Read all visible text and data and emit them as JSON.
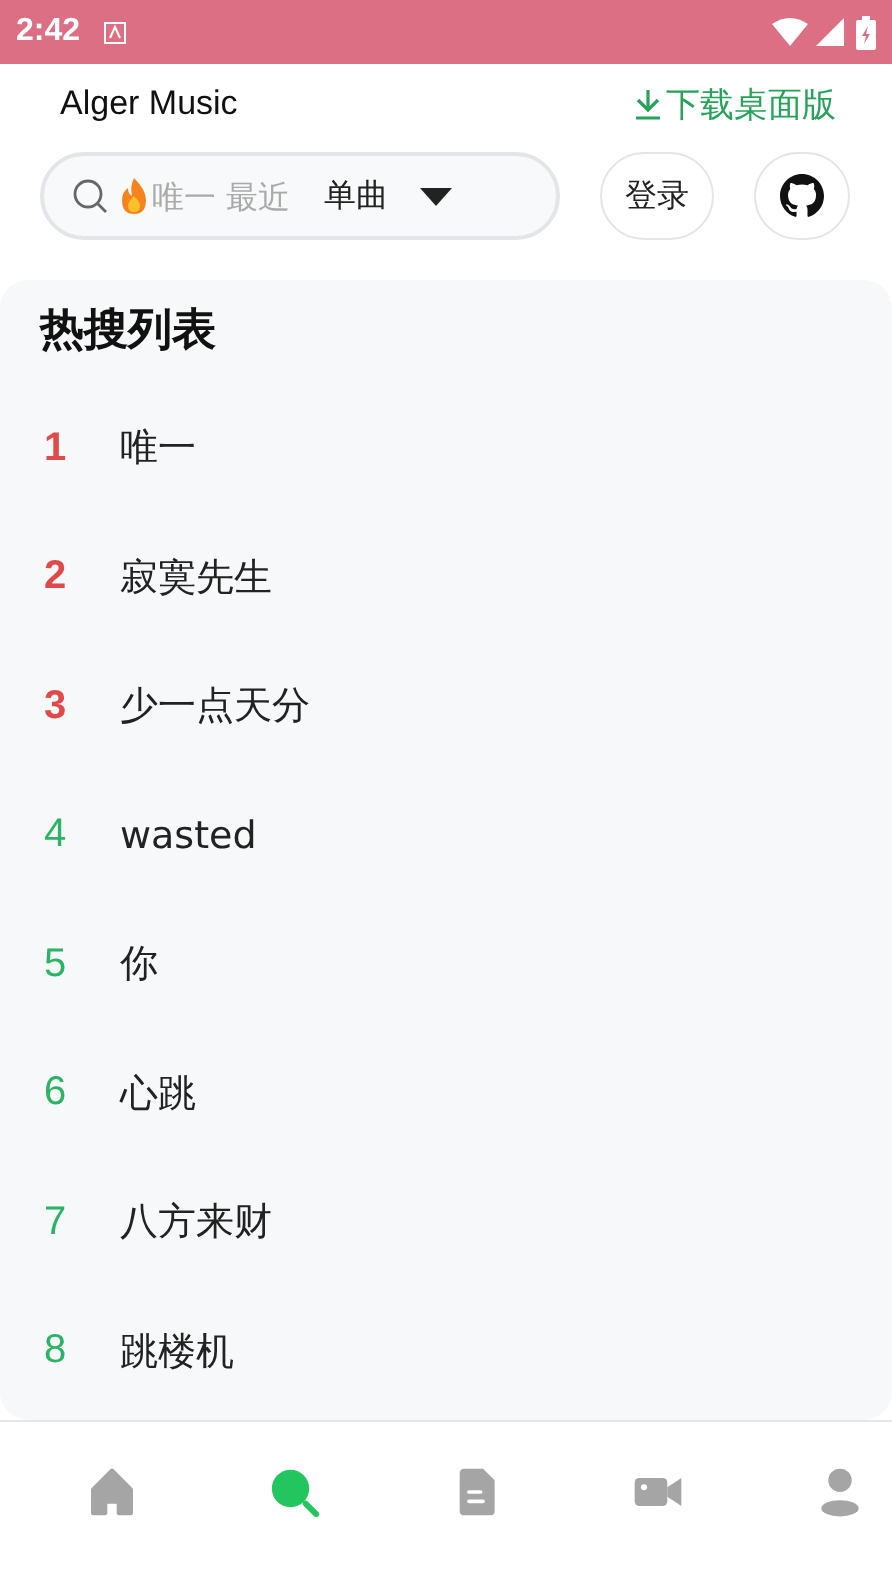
{
  "status_bar": {
    "time": "2:42"
  },
  "header": {
    "app_name": "Alger Music",
    "download_link": "下载桌面版"
  },
  "search": {
    "placeholder": "唯一 最近",
    "type_select": "单曲",
    "login_button": "登录"
  },
  "hot_search": {
    "title": "热搜列表",
    "items": [
      {
        "rank": "1",
        "name": "唯一",
        "color": "#e04a4a"
      },
      {
        "rank": "2",
        "name": "寂寞先生",
        "color": "#e04a4a"
      },
      {
        "rank": "3",
        "name": "少一点天分",
        "color": "#e04a4a"
      },
      {
        "rank": "4",
        "name": "wasted",
        "color": "#2bb463"
      },
      {
        "rank": "5",
        "name": "你",
        "color": "#2bb463"
      },
      {
        "rank": "6",
        "name": "心跳",
        "color": "#2bb463"
      },
      {
        "rank": "7",
        "name": "八方来财",
        "color": "#2bb463"
      },
      {
        "rank": "8",
        "name": "跳楼机",
        "color": "#2bb463"
      }
    ]
  },
  "bottom_nav": [
    {
      "kind": "home",
      "selected": false
    },
    {
      "kind": "search",
      "selected": true
    },
    {
      "kind": "list",
      "selected": false
    },
    {
      "kind": "video",
      "selected": false
    },
    {
      "kind": "user",
      "selected": false
    }
  ]
}
